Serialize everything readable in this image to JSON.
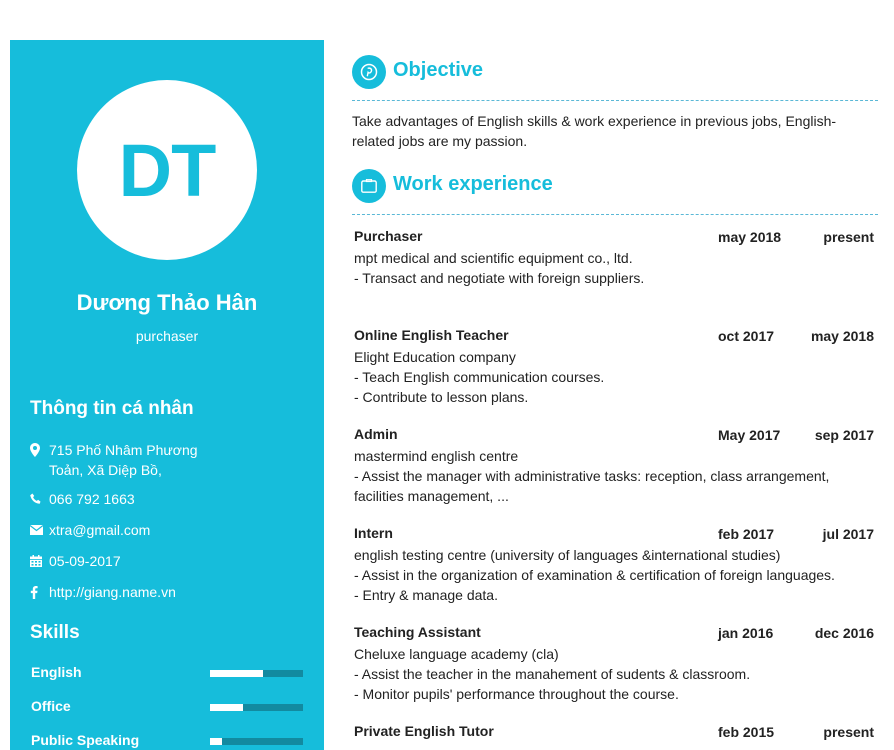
{
  "sidebar": {
    "initials": "DT",
    "name": "Dương Thảo Hân",
    "role": "purchaser",
    "personal_title": "Thông tin cá nhân",
    "address_line1": "715 Phố Nhâm Phương",
    "address_line2": "Toản, Xã Diệp Bồ,",
    "phone": "066 792 1663",
    "email": "xtra@gmail.com",
    "birthday": "05-09-2017",
    "website": "http://giang.name.vn",
    "skills_title": "Skills",
    "skills": [
      {
        "label": "English",
        "level": 0.57
      },
      {
        "label": "Office",
        "level": 0.35
      },
      {
        "label": "Public Speaking",
        "level": 0.13
      }
    ]
  },
  "main": {
    "objective_title": "Objective",
    "objective_text": "Take advantages of English skills & work experience in previous jobs, English-related jobs are my passion.",
    "work_title": "Work experience",
    "jobs": [
      {
        "title": "Purchaser",
        "start": "may 2018",
        "end": "present",
        "company": "mpt medical and scientific equipment co., ltd.",
        "duties": [
          "- Transact and negotiate with foreign suppliers."
        ]
      },
      {
        "title": "Online English Teacher",
        "start": "oct 2017",
        "end": "may 2018",
        "company": "Elight Education company",
        "duties": [
          "- Teach English communication courses.",
          "- Contribute to lesson plans."
        ]
      },
      {
        "title": "Admin",
        "start": "May 2017",
        "end": "sep 2017",
        "company": "mastermind english centre",
        "duties": [
          "- Assist the manager with administrative tasks: reception, class arrangement, facilities management, ..."
        ]
      },
      {
        "title": "Intern",
        "start": "feb 2017",
        "end": "jul 2017",
        "company": "english testing centre (university of languages &international studies)",
        "duties": [
          "- Assist in the organization of examination & certification of foreign languages.",
          "- Entry & manage data."
        ]
      },
      {
        "title": "Teaching Assistant",
        "start": "jan 2016",
        "end": "dec 2016",
        "company": "Cheluxe language academy (cla)",
        "duties": [
          "- Assist the teacher in the manahement of sudents & classroom.",
          "- Monitor pupils' performance throughout the course."
        ]
      },
      {
        "title": "Private English Tutor",
        "start": "feb 2015",
        "end": "present",
        "company": "",
        "duties": []
      }
    ]
  },
  "colors": {
    "accent": "#16bddb",
    "skill_track": "#128aa0",
    "text": "#222222"
  }
}
